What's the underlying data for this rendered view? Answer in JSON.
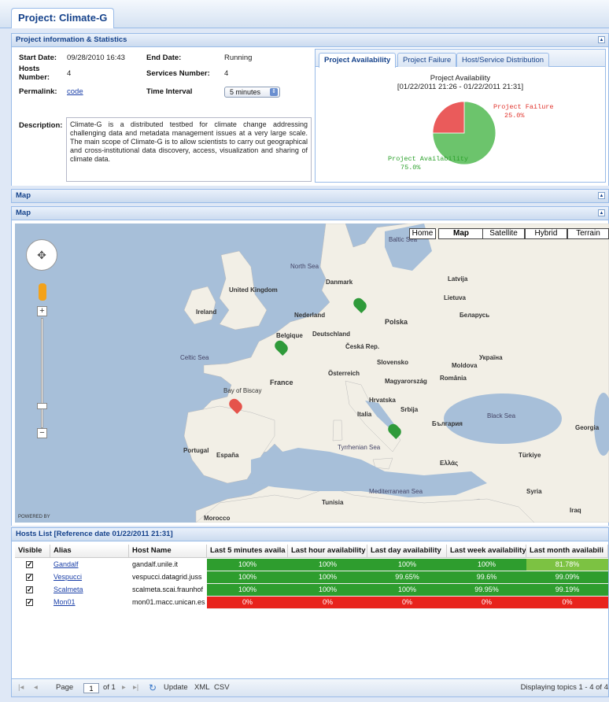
{
  "project_tab": "Project: Climate-G",
  "info_panel": {
    "title": "Project information & Statistics",
    "start_date_label": "Start Date:",
    "start_date": "09/28/2010 16:43",
    "end_date_label": "End Date:",
    "end_date": "Running",
    "hosts_number_label": "Hosts Number:",
    "hosts_number": "4",
    "services_number_label": "Services Number:",
    "services_number": "4",
    "permalink_label": "Permalink:",
    "permalink": "code",
    "time_interval_label": "Time Interval",
    "time_interval_value": "5 minutes",
    "description_label": "Description:",
    "description": "Climate-G is a distributed testbed for climate change addressing challenging data and metadata management issues at a very large scale. The main scope of Climate-G is to allow scientists to carry out geographical and cross-institutional data discovery, access, visualization and sharing of climate data."
  },
  "chart_tabs": [
    "Project Availability",
    "Project Failure",
    "Host/Service Distribution"
  ],
  "chart_data": {
    "type": "pie",
    "title": "Project Availability",
    "subtitle": "[01/22/2011 21:26 - 01/22/2011 21:31]",
    "slices": [
      {
        "label": "Project Availability",
        "value": 75.0,
        "display": "75.0%",
        "color": "#6cc46c"
      },
      {
        "label": "Project Failure",
        "value": 25.0,
        "display": "25.0%",
        "color": "#ea5b5b"
      }
    ]
  },
  "map_panel_collapsed_title": "Map",
  "map_panel_title": "Map",
  "map": {
    "buttons": [
      "Home",
      "Map",
      "Satellite",
      "Hybrid",
      "Terrain"
    ],
    "powered_by": "POWERED BY",
    "labels": [
      "Baltic Sea",
      "North Sea",
      "Celtic Sea",
      "Bay of Biscay",
      "Black Sea",
      "Mediterranean Sea",
      "Tyrrhenian Sea",
      "Danmark",
      "Latvija",
      "Lietuva",
      "Nederland",
      "Polska",
      "Deutschland",
      "France",
      "España",
      "Portugal",
      "Italia",
      "Ireland",
      "United Kingdom",
      "România",
      "Türkiye",
      "Україна",
      "Беларусь",
      "Georgia",
      "Syria",
      "Iraq",
      "Tunisia",
      "Morocco",
      "Hrvatska",
      "Srbija",
      "Moldova",
      "Slovensko",
      "Česká Rep.",
      "Österreich",
      "Magyarország",
      "Belgique",
      "Ελλάς",
      "България"
    ]
  },
  "hosts": {
    "title": "Hosts List [Reference date 01/22/2011 21:31]",
    "columns": [
      "Visible",
      "Alias",
      "Host Name",
      "Last 5 minutes availa",
      "Last hour availability",
      "Last day availability",
      "Last week availability",
      "Last month availabili"
    ],
    "rows": [
      {
        "alias": "Gandalf",
        "host": "gandalf.unile.it",
        "v": [
          "100%",
          "100%",
          "100%",
          "100%",
          "81.78%"
        ]
      },
      {
        "alias": "Vespucci",
        "host": "vespucci.datagrid.juss",
        "v": [
          "100%",
          "100%",
          "99.65%",
          "99.6%",
          "99.09%"
        ]
      },
      {
        "alias": "Scalmeta",
        "host": "scalmeta.scai.fraunhof",
        "v": [
          "100%",
          "100%",
          "100%",
          "99.95%",
          "99.19%"
        ]
      },
      {
        "alias": "Mon01",
        "host": "mon01.macc.unican.es",
        "v": [
          "0%",
          "0%",
          "0%",
          "0%",
          "0%"
        ]
      }
    ]
  },
  "pager": {
    "page_label": "Page",
    "page_value": "1",
    "of_label": "of 1",
    "update": "Update",
    "xml": "XML",
    "csv": "CSV",
    "displaying": "Displaying topics 1 - 4 of 4"
  },
  "colors": {
    "green": "#2e9d2e",
    "light_green": "#7cc242",
    "red": "#e8231c"
  }
}
